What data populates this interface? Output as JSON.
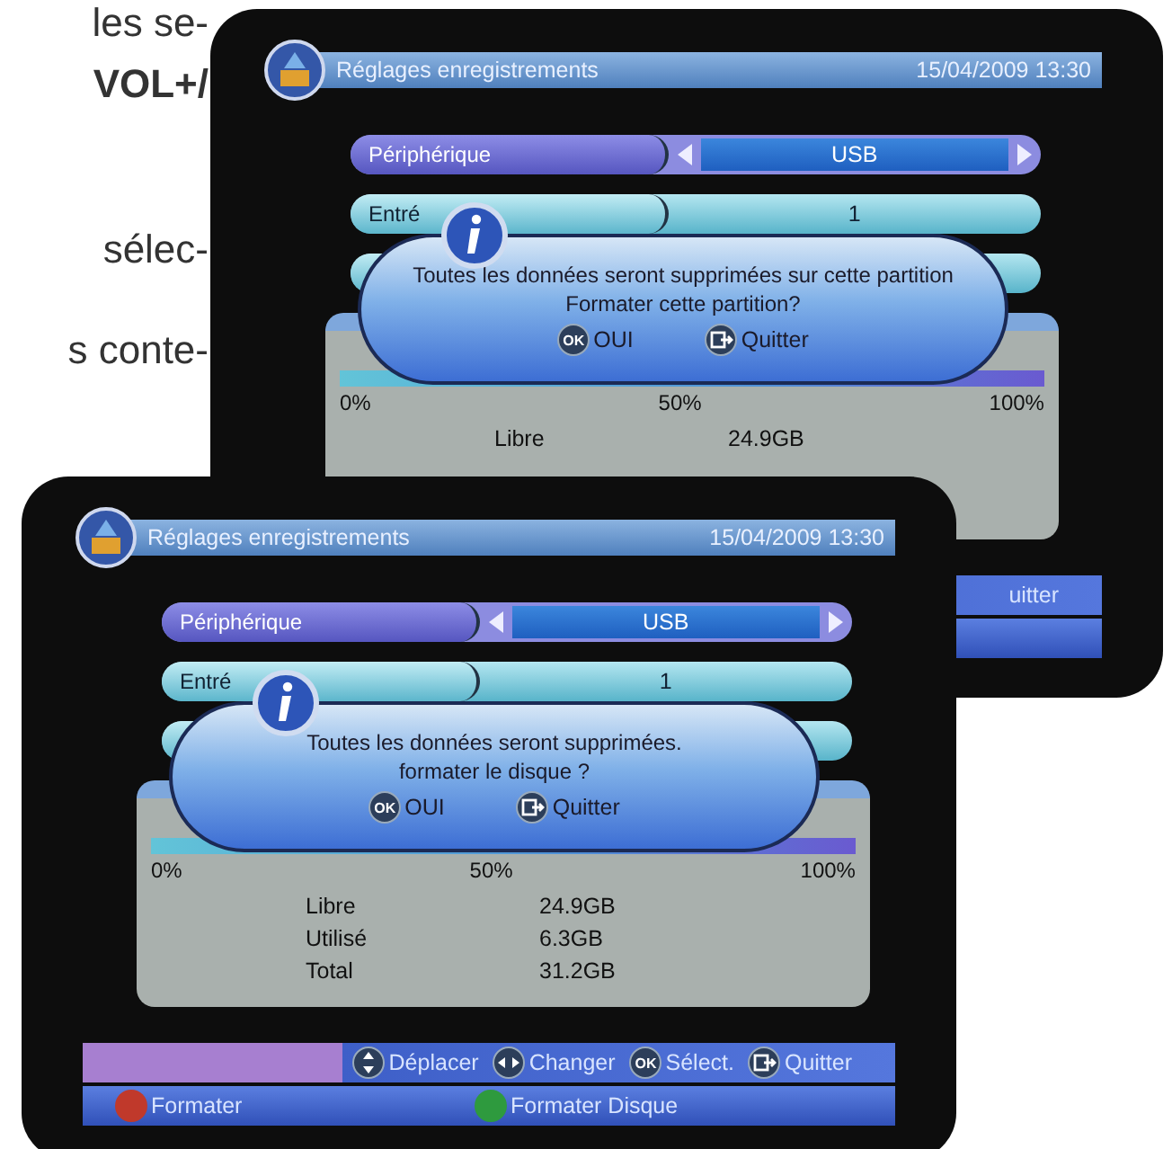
{
  "manual_text": [
    {
      "text": "les se-",
      "bold": false
    },
    {
      "text": "VOL+/",
      "bold": true
    },
    {
      "text": "sélec-",
      "bold": false
    },
    {
      "text": "s conte-",
      "bold": false
    }
  ],
  "screens": [
    {
      "title": "Réglages enregistrements",
      "datetime": "15/04/2009 13:30",
      "settings": [
        {
          "label": "Périphérique",
          "value": "USB",
          "selected": true
        },
        {
          "label": "Entré",
          "value": "1",
          "selected": false
        },
        {
          "selected": false
        }
      ],
      "dialog": {
        "lines": [
          "Toutes les données seront supprimées sur cette partition",
          "Formater cette partition?"
        ],
        "buttons": [
          {
            "kind": "ok",
            "key": "OK",
            "label": "OUI"
          },
          {
            "kind": "exit",
            "label": "Quitter"
          }
        ]
      },
      "usage": {
        "scale": [
          "0%",
          "50%",
          "100%"
        ],
        "stats": [
          {
            "label": "Libre",
            "value": "24.9GB"
          }
        ]
      },
      "footer": {
        "hints": [
          {
            "kind": "text",
            "label": "uitter"
          }
        ]
      }
    },
    {
      "title": "Réglages enregistrements",
      "datetime": "15/04/2009 13:30",
      "settings": [
        {
          "label": "Périphérique",
          "value": "USB",
          "selected": true
        },
        {
          "label": "Entré",
          "value": "1",
          "selected": false
        },
        {
          "selected": false
        }
      ],
      "dialog": {
        "lines": [
          "Toutes les données seront supprimées.",
          "formater le disque ?"
        ],
        "buttons": [
          {
            "kind": "ok",
            "key": "OK",
            "label": "OUI"
          },
          {
            "kind": "exit",
            "label": "Quitter"
          }
        ]
      },
      "usage": {
        "scale": [
          "0%",
          "50%",
          "100%"
        ],
        "stats": [
          {
            "label": "Libre",
            "value": "24.9GB"
          },
          {
            "label": "Utilisé",
            "value": "6.3GB"
          },
          {
            "label": "Total",
            "value": "31.2GB"
          }
        ]
      },
      "footer": {
        "hints": [
          {
            "kind": "updown",
            "label": "Déplacer"
          },
          {
            "kind": "leftright",
            "label": "Changer"
          },
          {
            "kind": "ok",
            "key": "OK",
            "label": "Sélect."
          },
          {
            "kind": "exit",
            "label": "Quitter"
          }
        ],
        "color_buttons": [
          {
            "label": "Formater",
            "color": "#c0392b"
          },
          {
            "label": "Formater Disque",
            "color": "#2e9a3e"
          }
        ]
      }
    }
  ]
}
